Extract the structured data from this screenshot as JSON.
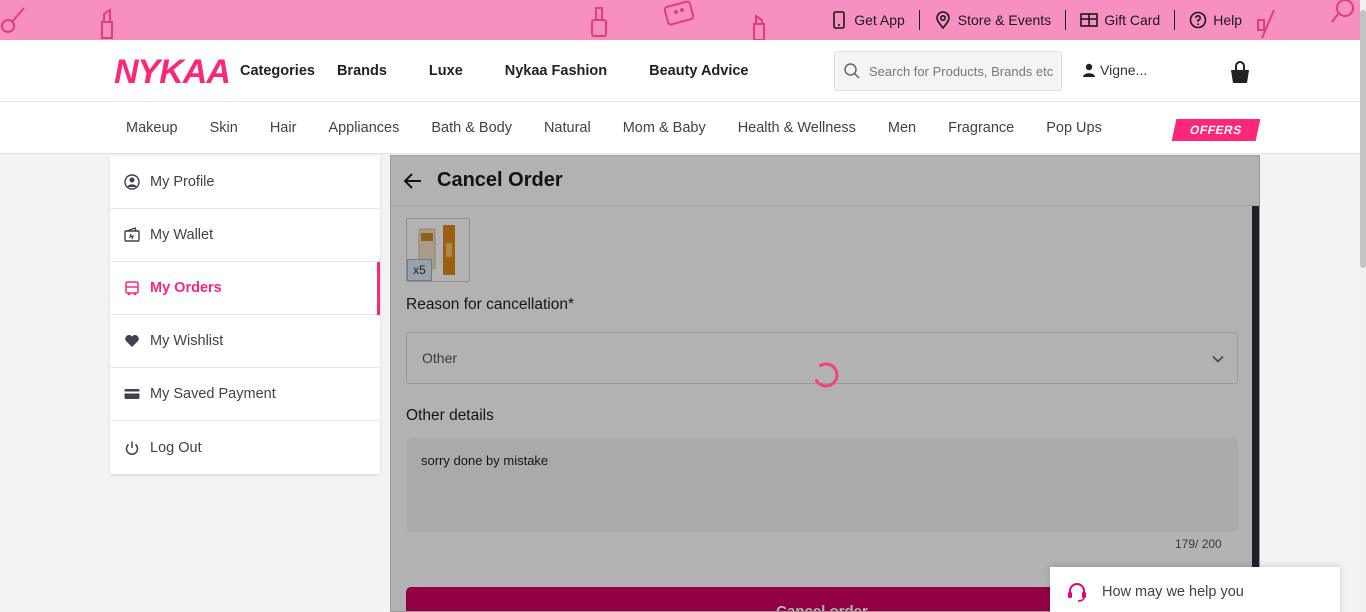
{
  "topbar": {
    "links": [
      {
        "label": "Get App",
        "icon": "phone-icon"
      },
      {
        "label": "Store & Events",
        "icon": "location-pin-icon"
      },
      {
        "label": "Gift Card",
        "icon": "gift-card-icon"
      },
      {
        "label": "Help",
        "icon": "help-icon"
      }
    ]
  },
  "header": {
    "logo": "NYKAA",
    "nav": [
      "Categories",
      "Brands",
      "Luxe",
      "Nykaa Fashion",
      "Beauty Advice"
    ],
    "search_placeholder": "Search for Products, Brands etc",
    "user": "Vigne..."
  },
  "categories": [
    "Makeup",
    "Skin",
    "Hair",
    "Appliances",
    "Bath & Body",
    "Natural",
    "Mom & Baby",
    "Health & Wellness",
    "Men",
    "Fragrance",
    "Pop Ups"
  ],
  "offers_label": "OFFERS",
  "sidebar": {
    "items": [
      {
        "label": "My Profile",
        "icon": "profile-icon"
      },
      {
        "label": "My Wallet",
        "icon": "wallet-icon"
      },
      {
        "label": "My Orders",
        "icon": "orders-icon",
        "active": true
      },
      {
        "label": "My Wishlist",
        "icon": "heart-icon"
      },
      {
        "label": "My Saved Payment",
        "icon": "card-icon"
      },
      {
        "label": "Log Out",
        "icon": "power-icon"
      }
    ]
  },
  "cancel": {
    "title": "Cancel Order",
    "quantity": "x5",
    "reason_label": "Reason for cancellation*",
    "reason_value": "Other",
    "details_label": "Other details",
    "details_value": "sorry done by mistake",
    "counter": "179/ 200",
    "button_label": "Cancel order"
  },
  "chat": {
    "label": "How may we help you"
  },
  "colors": {
    "brand": "#fc2779",
    "cancel_button": "#d10062",
    "topbar": "#f78fbf"
  }
}
